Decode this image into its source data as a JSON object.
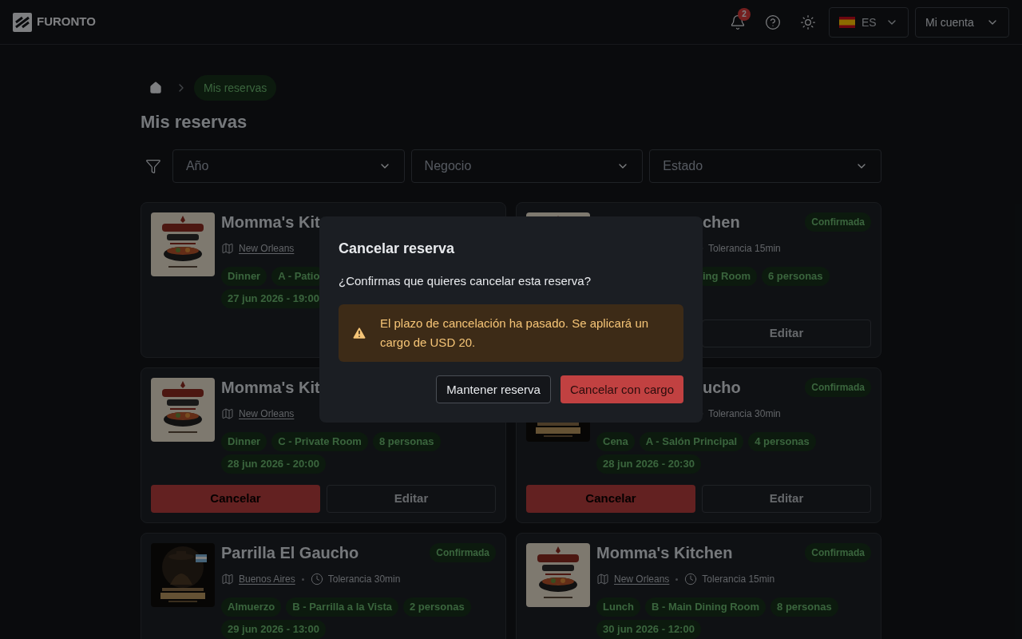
{
  "header": {
    "brand": "FURONTO",
    "notifications": "2",
    "language": "ES",
    "account": "Mi cuenta"
  },
  "breadcrumb": {
    "current": "Mis reservas"
  },
  "page_title": "Mis reservas",
  "filters": [
    {
      "placeholder": "Año"
    },
    {
      "placeholder": "Negocio"
    },
    {
      "placeholder": "Estado"
    }
  ],
  "cards": [
    {
      "title": "Momma's Kit",
      "location": "New Orleans",
      "tags": [
        "Dinner",
        "A - Patio"
      ],
      "date": "27 jun 2026 - 19:00"
    },
    {
      "title": "chen",
      "status": "Confirmada",
      "tolerance": "Tolerancia 15min",
      "tags": [
        "ing Room",
        "6 personas"
      ],
      "buttons": [
        {
          "kind": "edit",
          "label": "Editar"
        }
      ]
    },
    {
      "title": "Momma's Kit",
      "location": "New Orleans",
      "tags": [
        "Dinner",
        "C - Private Room",
        "8 personas"
      ],
      "date": "28 jun 2026 - 20:00",
      "buttons": [
        {
          "kind": "cancel",
          "label": "Cancelar"
        },
        {
          "kind": "edit",
          "label": "Editar"
        }
      ]
    },
    {
      "title": "ucho",
      "status": "Confirmada",
      "tolerance": "Tolerancia 30min",
      "tags": [
        "Cena",
        "A - Salón Principal",
        "4 personas"
      ],
      "date": "28 jun 2026 - 20:30",
      "buttons": [
        {
          "kind": "cancel",
          "label": "Cancelar"
        },
        {
          "kind": "edit",
          "label": "Editar"
        }
      ]
    },
    {
      "title": "Parrilla El Gaucho",
      "status": "Confirmada",
      "location": "Buenos Aires",
      "tolerance": "Tolerancia 30min",
      "tags": [
        "Almuerzo",
        "B - Parrilla a la Vista",
        "2 personas"
      ],
      "date": "29 jun 2026 - 13:00"
    },
    {
      "title": "Momma's Kitchen",
      "status": "Confirmada",
      "location": "New Orleans",
      "tolerance": "Tolerancia 15min",
      "tags": [
        "Lunch",
        "B - Main Dining Room",
        "8 personas"
      ],
      "date": "30 jun 2026 - 12:00"
    }
  ],
  "dialog": {
    "title": "Cancelar reserva",
    "message": "¿Confirmas que quieres cancelar esta reserva?",
    "warning": "El plazo de cancelación ha pasado. Se aplicará un cargo de USD 20.",
    "buttons": [
      {
        "kind": "secondary",
        "label": "Mantener reserva"
      },
      {
        "kind": "danger",
        "label": "Cancelar con cargo"
      }
    ]
  }
}
